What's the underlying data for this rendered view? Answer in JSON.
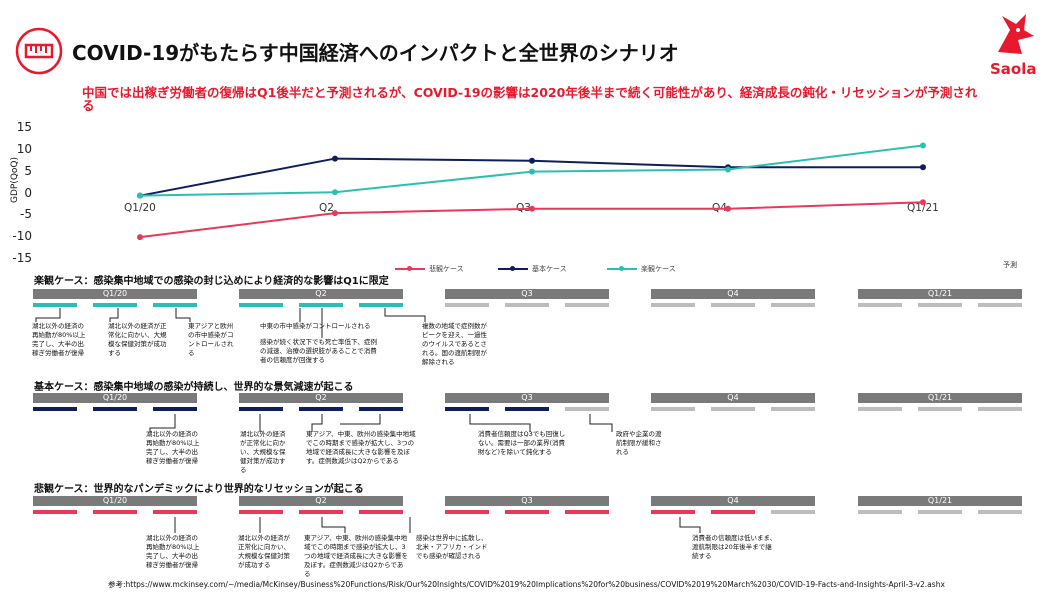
{
  "header": {
    "title": "COVID-19がもたらす中国経済へのインパクトと全世界のシナリオ",
    "subtitle": "中国では出稼ぎ労働者の復帰はQ1後半だと予測されるが、COVID-19の影響は2020年後半まで続く可能性があり、経済成長の鈍化・リセッションが予測される",
    "brand": "Saola",
    "accent_color": "#e8192c"
  },
  "chart_data": {
    "type": "line",
    "categories": [
      "Q1/20",
      "Q2",
      "Q3",
      "Q4",
      "Q1/21"
    ],
    "series": [
      {
        "name": "悲観ケース",
        "color": "#e8395a",
        "values": [
          -10,
          -4.5,
          -3.5,
          -3.5,
          -2
        ]
      },
      {
        "name": "基本ケース",
        "color": "#0e1e5b",
        "values": [
          -0.5,
          8,
          7.5,
          6,
          6
        ]
      },
      {
        "name": "楽観ケース",
        "color": "#2bbfb3",
        "values": [
          -0.5,
          0.3,
          5,
          5.5,
          11
        ]
      }
    ],
    "ylabel": "GDP(QoQ)",
    "ylim": [
      -15,
      15
    ],
    "yticks": [
      15,
      10,
      5,
      0,
      -5,
      -10,
      -15
    ],
    "grid": false,
    "legend_position": "bottom",
    "annotation": "予測"
  },
  "scenarios": [
    {
      "title": "楽観ケース：感染集中地域での感染の封じ込めにより経済的な影響はQ1に限定",
      "color": "#2bbfb3",
      "quarters": [
        "Q1/20",
        "Q2",
        "Q3",
        "Q4",
        "Q1/21"
      ],
      "notes": [
        "湖北以外の経済の再始動が80%以上完了し、大半の出稼ぎ労働者が復帰",
        "湖北以外の経済が正常化に向かい、大規模な保健対策が成功する",
        "東アジアと欧州の市中感染がコントロールされる",
        "中東の市中感染がコントロールされる",
        "感染が続く状況下でも死亡率低下、症例の減速、治療の選択肢があることで消費者の信頼度が回復する",
        "複数の地域で症例数がピークを迎え、一過性のウイルスであるとされる。国の渡航制限が解除される"
      ]
    },
    {
      "title": "基本ケース：感染集中地域の感染が持続し、世界的な景気減速が起こる",
      "color": "#0e1e5b",
      "quarters": [
        "Q1/20",
        "Q2",
        "Q3",
        "Q4",
        "Q1/21"
      ],
      "notes": [
        "湖北以外の経済の再始動が80%以上完了し、大半の出稼ぎ労働者が復帰",
        "湖北以外の経済が正常化に向かい、大規模な保健対策が成功する",
        "東アジア、中東、欧州の感染集中地域でこの時期まで感染が拡大し、3つの地域で経済成長に大きな影響を及ぼす。症例数減少はQ2からである",
        "消費者信頼度はQ3でも回復しない。需要は一部の業界(消費財など)を除いて鈍化する",
        "政府や企業の渡航制限が緩和される"
      ]
    },
    {
      "title": "悲観ケース：世界的なパンデミックにより世界的なリセッションが起こる",
      "color": "#e8395a",
      "quarters": [
        "Q1/20",
        "Q2",
        "Q3",
        "Q4",
        "Q1/21"
      ],
      "notes": [
        "湖北以外の経済の再始動が80%以上完了し、大半の出稼ぎ労働者が復帰",
        "湖北以外の経済が正常化に向かい、大規模な保健対策が成功する",
        "東アジア、中東、欧州の感染集中地域でこの時期まで感染が拡大し、3つの地域で経済成長に大きな影響を及ぼす。症例数減少はQ2からである",
        "感染は世界中に拡散し、北米・アフリカ・インドでも感染が確認される",
        "消費者の信頼度は低いまま、渡航制限は20年後半まで継続する"
      ]
    }
  ],
  "reference": "参考:https://www.mckinsey.com/~/media/McKinsey/Business%20Functions/Risk/Our%20Insights/COVID%2019%20Implications%20for%20business/COVID%2019%20March%2030/COVID-19-Facts-and-Insights-April-3-v2.ashx"
}
